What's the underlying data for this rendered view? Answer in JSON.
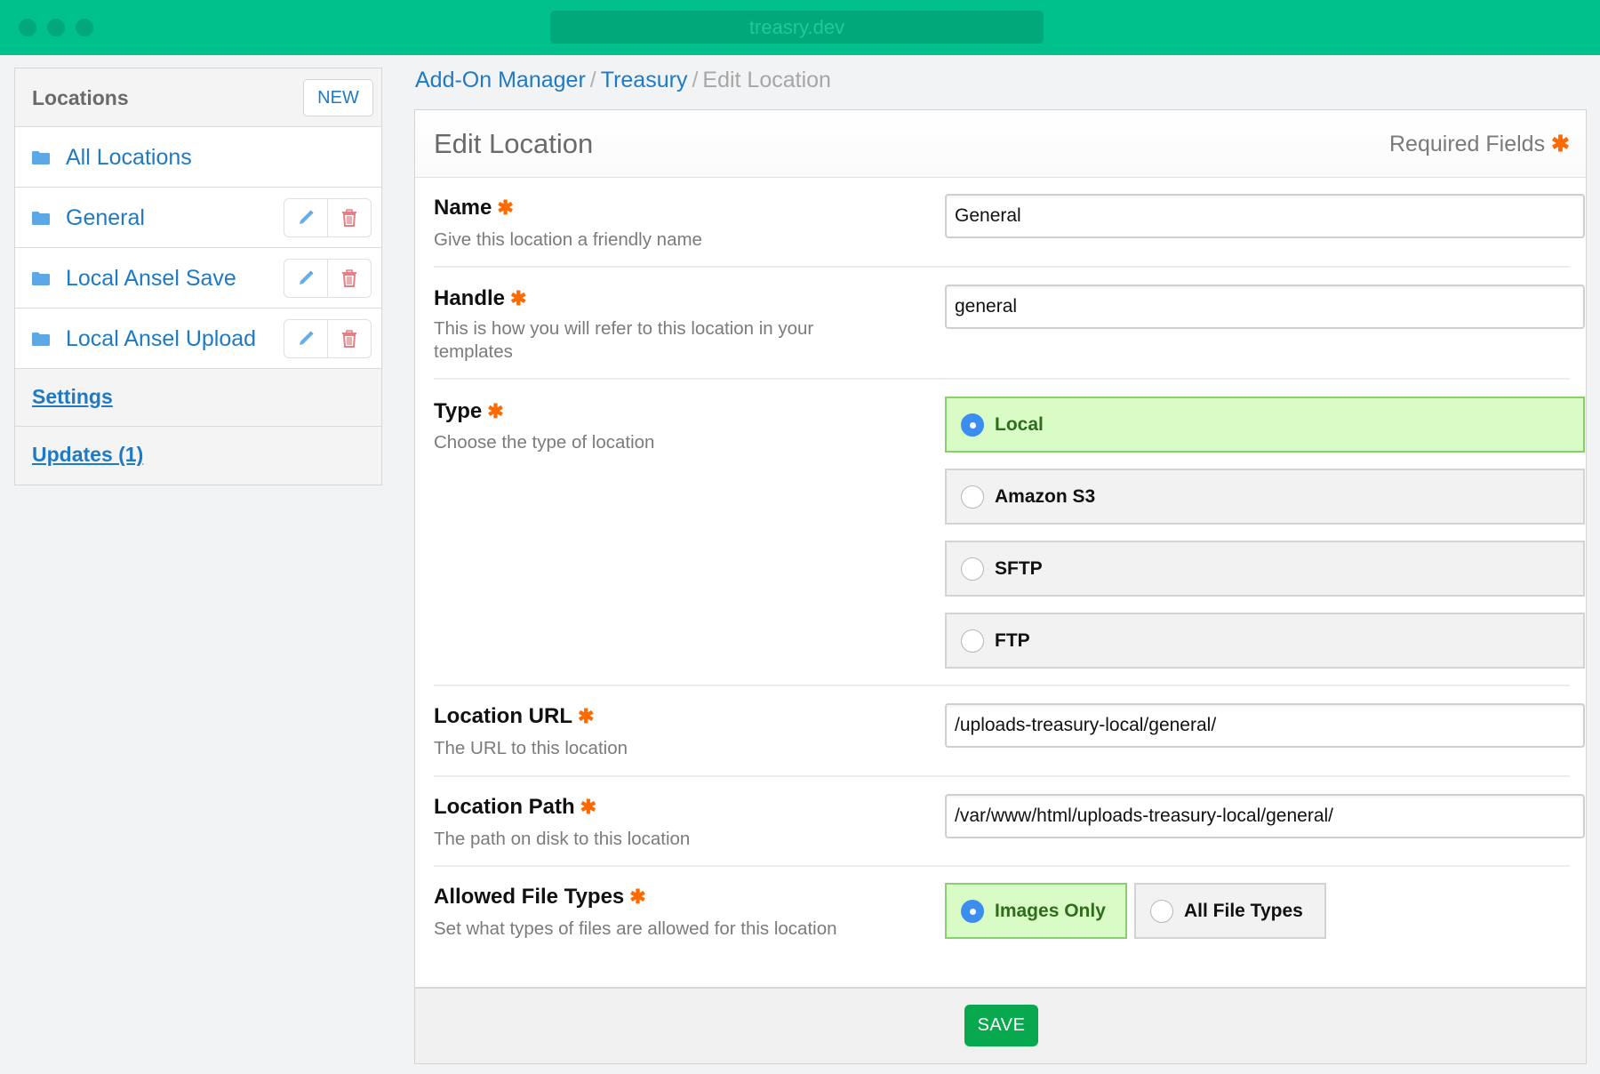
{
  "window": {
    "url": "treasry.dev"
  },
  "sidebar": {
    "title": "Locations",
    "new_label": "NEW",
    "items": [
      {
        "label": "All Locations",
        "icon": "folder-icon",
        "has_actions": false
      },
      {
        "label": "General",
        "icon": "folder-icon",
        "has_actions": true
      },
      {
        "label": "Local Ansel Save",
        "icon": "folder-icon",
        "has_actions": true
      },
      {
        "label": "Local Ansel Upload",
        "icon": "folder-icon",
        "has_actions": true
      }
    ],
    "links": [
      {
        "label": "Settings"
      },
      {
        "label": "Updates (1)"
      }
    ]
  },
  "breadcrumb": {
    "items": [
      "Add-On Manager",
      "Treasury",
      "Edit Location"
    ],
    "separator": "/"
  },
  "panel": {
    "title": "Edit Location",
    "required_label": "Required Fields",
    "required_mark": "✱"
  },
  "fields": {
    "name": {
      "label": "Name",
      "desc": "Give this location a friendly name",
      "value": "General"
    },
    "handle": {
      "label": "Handle",
      "desc": "This is how you will refer to this location in your templates",
      "value": "general"
    },
    "type": {
      "label": "Type",
      "desc": "Choose the type of location",
      "selected": "Local",
      "options": [
        "Local",
        "Amazon S3",
        "SFTP",
        "FTP"
      ]
    },
    "url": {
      "label": "Location URL",
      "desc": "The URL to this location",
      "value": "/uploads-treasury-local/general/"
    },
    "path": {
      "label": "Location Path",
      "desc": "The path on disk to this location",
      "value": "/var/www/html/uploads-treasury-local/general/"
    },
    "file_types": {
      "label": "Allowed File Types",
      "desc": "Set what types of files are allowed for this location",
      "selected": "Images Only",
      "options": [
        "Images Only",
        "All File Types"
      ]
    }
  },
  "footer": {
    "save_label": "SAVE"
  },
  "colors": {
    "brand": "#00c08b",
    "link": "#1f7ac3",
    "required": "#ff6a00",
    "selected_bg": "#d9fcc7",
    "save": "#07a84e"
  }
}
